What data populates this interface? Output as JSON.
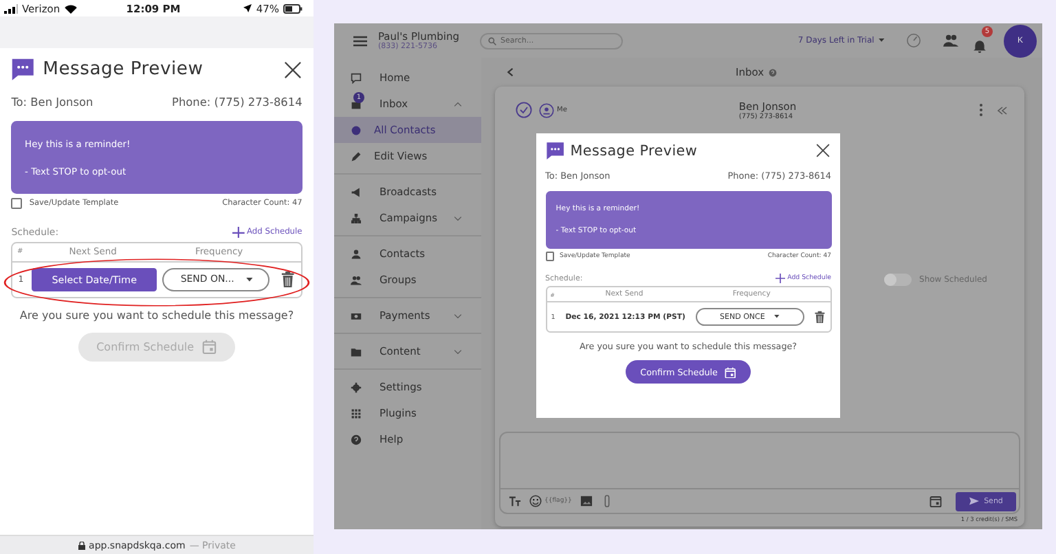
{
  "phone": {
    "status_bar": {
      "carrier": "Verizon",
      "time": "12:09 PM",
      "battery": "47%"
    },
    "modal": {
      "title": "Message Preview",
      "to": "To: Ben Jonson",
      "phone": "Phone: (775) 273-8614",
      "message": [
        "Hey this is a reminder!",
        "- Text STOP to opt-out"
      ],
      "save_template": {
        "label": "Save/Update Template",
        "checked": false
      },
      "character_count": "Character Count: 47",
      "schedule_label": "Schedule:",
      "add_schedule": "Add Schedule",
      "columns": [
        "#",
        "Next Send",
        "Frequency"
      ],
      "rows": [
        {
          "index": "1",
          "next_send": {
            "kind": "button",
            "text": "Select Date/Time"
          },
          "frequency": "SEND ON..."
        }
      ],
      "question": "Are you sure you want to schedule this message?",
      "confirm": {
        "label": "Confirm Schedule",
        "disabled": true
      }
    },
    "annotation": {
      "kind": "ellipse",
      "color": "#e02020"
    },
    "url_bar": {
      "domain": "app.snapdskqa.com",
      "suffix": "— Private"
    }
  },
  "desktop": {
    "top_bar": {
      "business": "Paul's Plumbing",
      "business_phone": "(833) 221-5736",
      "search": {
        "placeholder": "Search..."
      },
      "trial": "7 Days Left in Trial",
      "notifications": "5",
      "avatar": "K"
    },
    "sidebar": {
      "sections": [
        [
          {
            "label": "Home",
            "selected": false
          },
          {
            "label": "Inbox",
            "selected": false,
            "badge": "1",
            "expanded": true,
            "children": [
              {
                "label": "All Contacts",
                "selected": true
              },
              {
                "label": "Edit Views",
                "selected": false
              }
            ]
          }
        ],
        [
          {
            "label": "Broadcasts",
            "selected": false
          },
          {
            "label": "Campaigns",
            "selected": false,
            "expanded": false
          }
        ],
        [
          {
            "label": "Contacts",
            "selected": false
          },
          {
            "label": "Groups",
            "selected": false
          }
        ],
        [
          {
            "label": "Payments",
            "selected": false,
            "expanded": false
          }
        ],
        [
          {
            "label": "Content",
            "selected": false,
            "expanded": false
          }
        ],
        [
          {
            "label": "Settings",
            "selected": false
          },
          {
            "label": "Plugins",
            "selected": false
          },
          {
            "label": "Help",
            "selected": false
          }
        ]
      ]
    },
    "main": {
      "title": "Inbox",
      "assignee": "Me",
      "contact_name": "Ben Jonson",
      "contact_phone": "(775) 273-8614",
      "show_scheduled": {
        "label": "Show Scheduled",
        "on": false
      },
      "composer": {
        "merge_field": "{{flag}}",
        "send": "Send",
        "credits": "1 / 3 credit(s) / SMS"
      }
    },
    "modal": {
      "title": "Message Preview",
      "to": "To: Ben Jonson",
      "phone": "Phone: (775) 273-8614",
      "message": [
        "Hey this is a reminder!",
        "- Text STOP to opt-out"
      ],
      "save_template": {
        "label": "Save/Update Template",
        "checked": false
      },
      "character_count": "Character Count: 47",
      "schedule_label": "Schedule:",
      "add_schedule": "Add Schedule",
      "columns": [
        "#",
        "Next Send",
        "Frequency"
      ],
      "rows": [
        {
          "index": "1",
          "next_send": {
            "kind": "text",
            "text": "Dec 16, 2021 12:13 PM (PST)"
          },
          "frequency": "SEND ONCE"
        }
      ],
      "question": "Are you sure you want to schedule this message?",
      "confirm": {
        "label": "Confirm Schedule",
        "disabled": false
      }
    }
  }
}
